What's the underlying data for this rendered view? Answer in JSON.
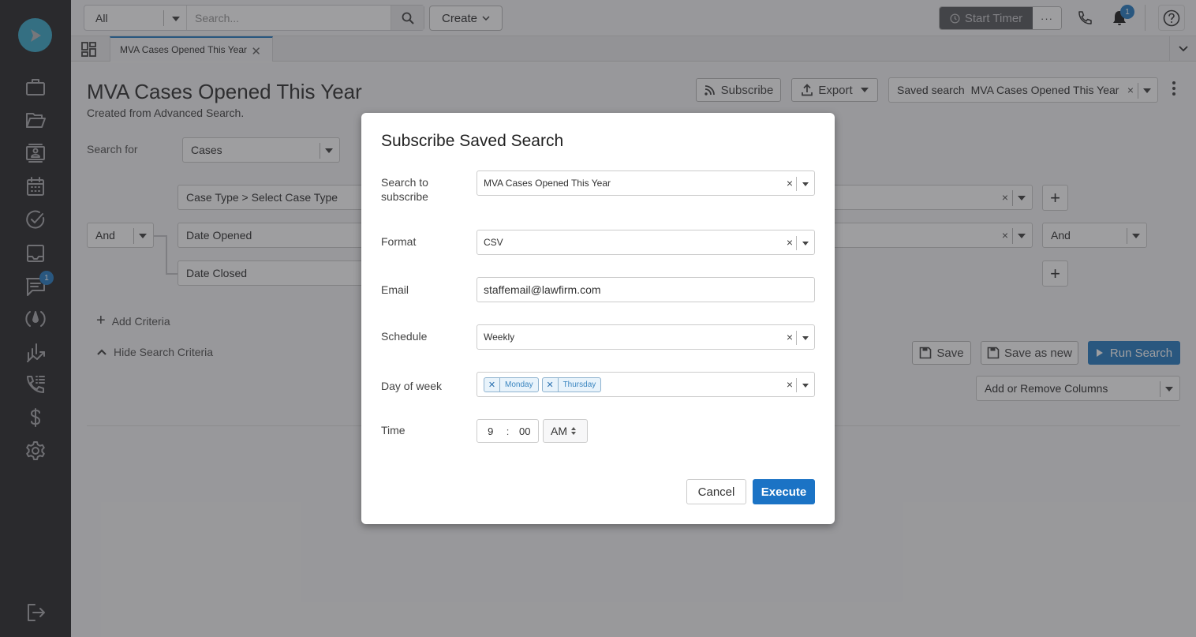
{
  "colors": {
    "accent": "#2a7ec4",
    "logo": "#3fa9c9",
    "sidebar": "#2c2c2e",
    "execute": "#1b73c5"
  },
  "sidebar": {
    "items": [
      {
        "icon": "briefcase-icon",
        "label": "Cases"
      },
      {
        "icon": "folder-open-icon",
        "label": "Documents"
      },
      {
        "icon": "contacts-icon",
        "label": "Contacts"
      },
      {
        "icon": "calendar-icon",
        "label": "Calendar"
      },
      {
        "icon": "check-circle-icon",
        "label": "Tasks"
      },
      {
        "icon": "inbox-icon",
        "label": "Inbox"
      },
      {
        "icon": "message-icon",
        "label": "Messages",
        "badge": "1"
      },
      {
        "icon": "intake-icon",
        "label": "Intake"
      },
      {
        "icon": "reports-chart-icon",
        "label": "Reports"
      },
      {
        "icon": "call-log-icon",
        "label": "Call Log"
      },
      {
        "icon": "dollar-icon",
        "label": "Billing"
      },
      {
        "icon": "gear-icon",
        "label": "Settings"
      }
    ],
    "logout_icon": "logout-icon"
  },
  "topbar": {
    "scope": "All",
    "search_placeholder": "Search...",
    "create_label": "Create",
    "timer_label": "Start Timer",
    "more_label": "···",
    "notification_count": "1"
  },
  "tabs": [
    {
      "label": "MVA Cases Opened This Year",
      "active": true
    }
  ],
  "page": {
    "title": "MVA Cases Opened This Year",
    "subtitle": "Created from Advanced Search.",
    "subscribe_label": "Subscribe",
    "export_label": "Export",
    "saved_search_prefix": "Saved search",
    "saved_search_value": "MVA Cases Opened This Year",
    "search_for_label": "Search for",
    "search_for_value": "Cases",
    "logic_operator": "And",
    "criteria": [
      {
        "field": "Case Type > Select Case Type"
      },
      {
        "field": "Date Opened"
      },
      {
        "field": "Date Closed"
      }
    ],
    "right_operator": "And",
    "add_criteria_label": "Add Criteria",
    "hide_criteria_label": "Hide Search Criteria",
    "save_label": "Save",
    "save_as_new_label": "Save as new",
    "run_search_label": "Run Search",
    "columns_label": "Add or Remove Columns"
  },
  "modal": {
    "title": "Subscribe Saved Search",
    "fields": {
      "search_label": "Search to subscribe",
      "search_value": "MVA Cases Opened This Year",
      "format_label": "Format",
      "format_value": "CSV",
      "email_label": "Email",
      "email_value": "staffemail@lawfirm.com",
      "schedule_label": "Schedule",
      "schedule_value": "Weekly",
      "day_label": "Day of week",
      "days": [
        "Monday",
        "Thursday"
      ],
      "time_label": "Time",
      "hour": "9",
      "minute": "00",
      "ampm": "AM"
    },
    "cancel_label": "Cancel",
    "execute_label": "Execute"
  }
}
